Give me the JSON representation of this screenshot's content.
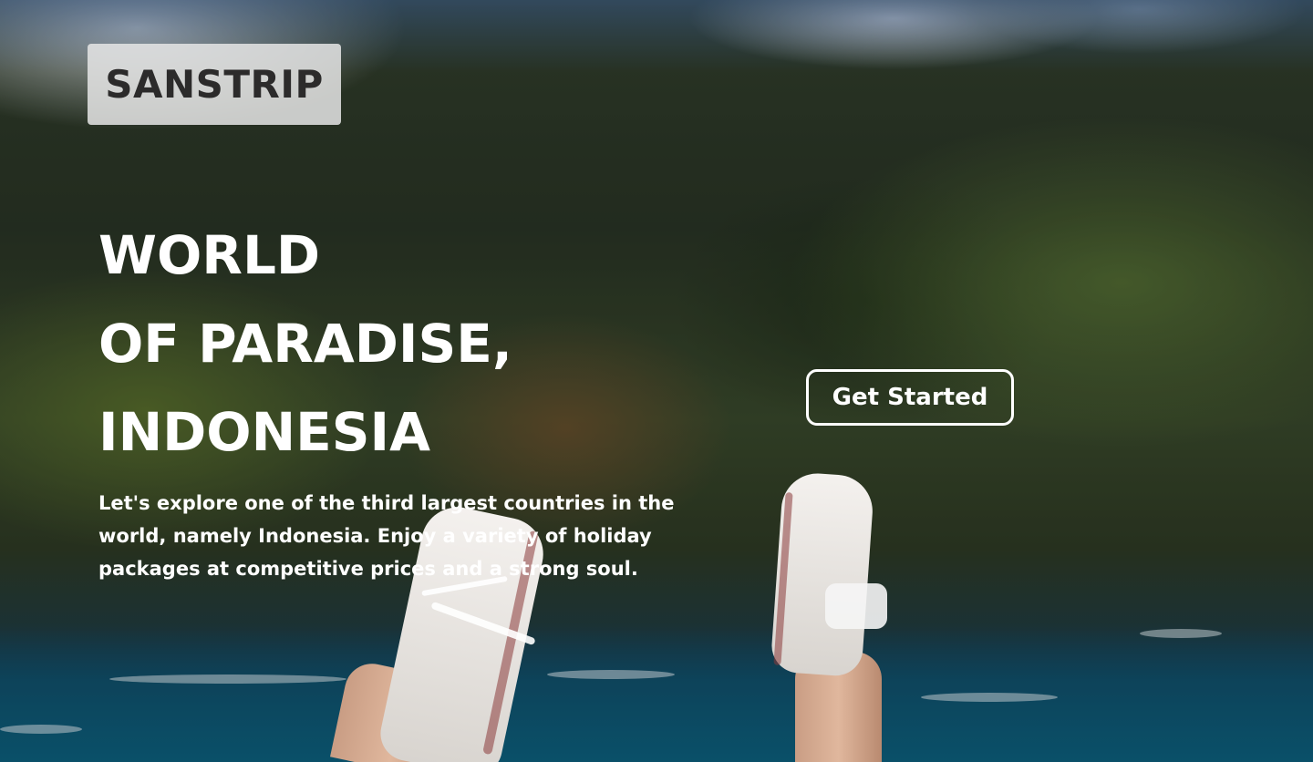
{
  "brand": {
    "logo_text": "SANSTRIP"
  },
  "hero": {
    "title_lines": [
      "WORLD",
      "OF PARADISE,",
      "INDONESIA"
    ],
    "description": "Let's explore one of the third largest countries in the world, namely Indonesia. Enjoy a variety of holiday packages at competitive prices and a strong soul.",
    "cta_label": "Get Started"
  },
  "colors": {
    "text": "#ffffff",
    "logo_text": "#2c2b2b",
    "logo_bg": "#e6e6e6"
  }
}
